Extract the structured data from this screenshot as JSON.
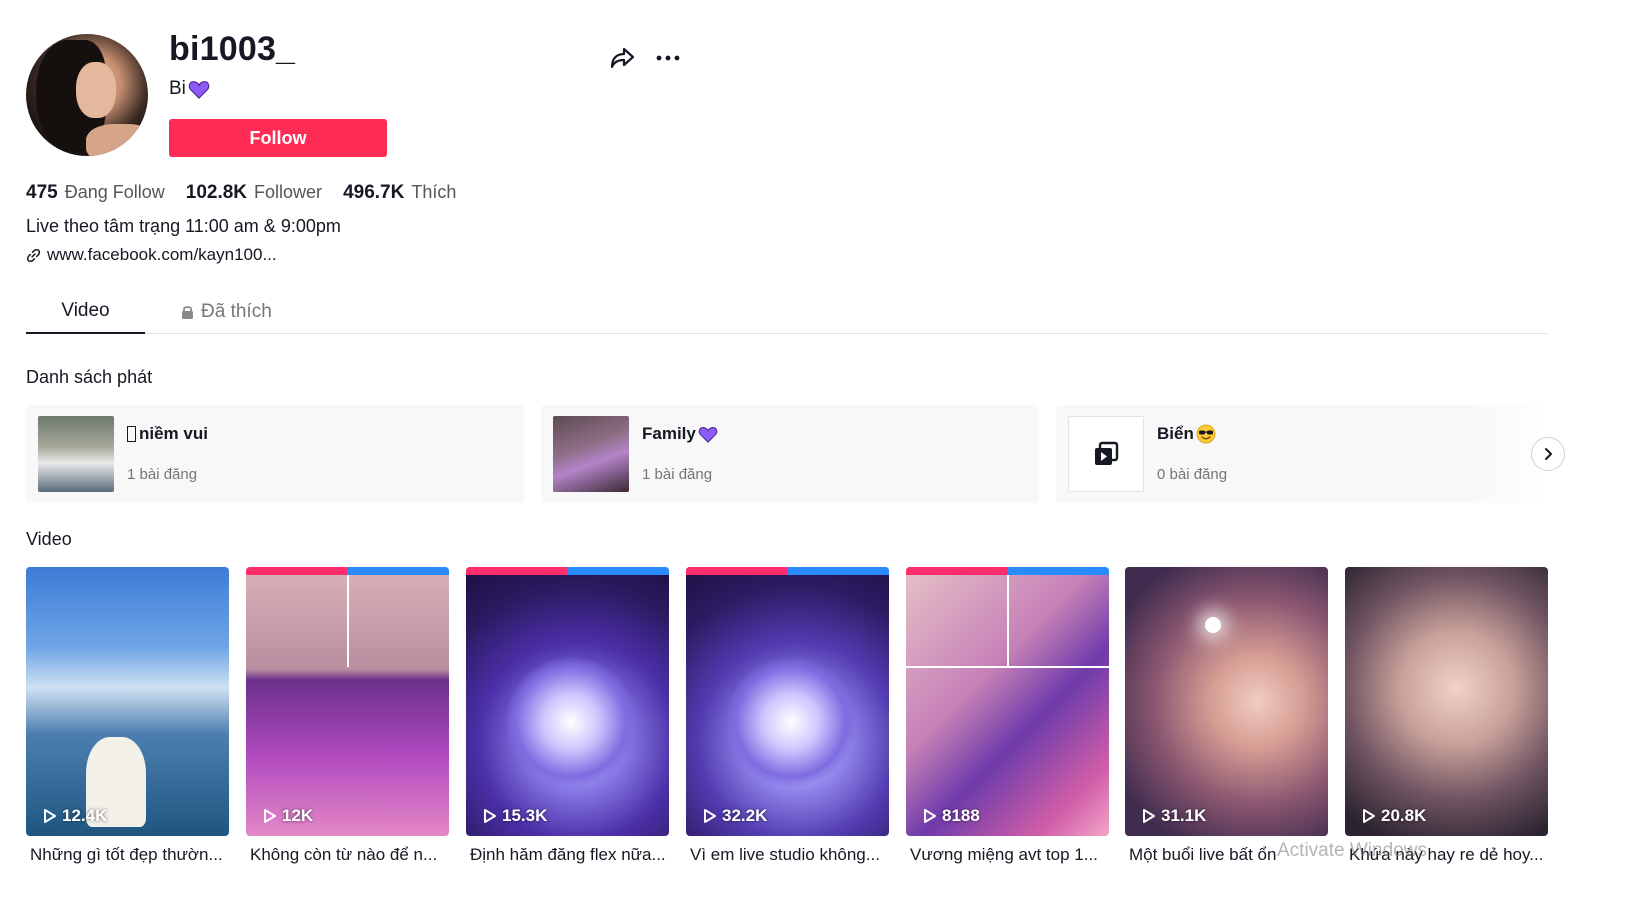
{
  "profile": {
    "username": "bi1003_",
    "nickname": "Bi",
    "follow_label": "Follow",
    "stats": [
      {
        "value": "475",
        "label": "Đang Follow"
      },
      {
        "value": "102.8K",
        "label": "Follower"
      },
      {
        "value": "496.7K",
        "label": "Thích"
      }
    ],
    "bio": "Live theo tâm trạng  11:00 am & 9:00pm",
    "link": "www.facebook.com/kayn100..."
  },
  "tabs": [
    {
      "label": "Video",
      "active": true
    },
    {
      "label": "Đã thích",
      "active": false
    }
  ],
  "playlists": {
    "title": "Danh sách phát",
    "items": [
      {
        "name": "niềm vui",
        "count": "1 bài đăng"
      },
      {
        "name": "Family",
        "count": "1 bài đăng"
      },
      {
        "name": "Biển",
        "count": "0 bài đăng"
      }
    ]
  },
  "videos": {
    "title": "Video",
    "items": [
      {
        "views": "12.4K",
        "caption": "Những gì tốt đẹp thườn..."
      },
      {
        "views": "12K",
        "caption": "Không còn từ nào để n..."
      },
      {
        "views": "15.3K",
        "caption": "Định hăm đăng flex nữa..."
      },
      {
        "views": "32.2K",
        "caption": "Vì em live studio không..."
      },
      {
        "views": "8188",
        "caption": "Vương miệng avt top 1..."
      },
      {
        "views": "31.1K",
        "caption": "Một buổi live bất ổn"
      },
      {
        "views": "20.8K",
        "caption": "Khứa này hay re dẻ hoy..."
      }
    ]
  },
  "os_watermark": "Activate Windows",
  "colors": {
    "accent": "#fe2c55",
    "heart": "#8b5cf6"
  },
  "icons": [
    "share-icon",
    "more-icon",
    "link-icon",
    "lock-icon",
    "play-icon",
    "chevron-right-icon",
    "playlist-stack-icon",
    "purple-heart-icon",
    "sunglasses-emoji-icon"
  ]
}
